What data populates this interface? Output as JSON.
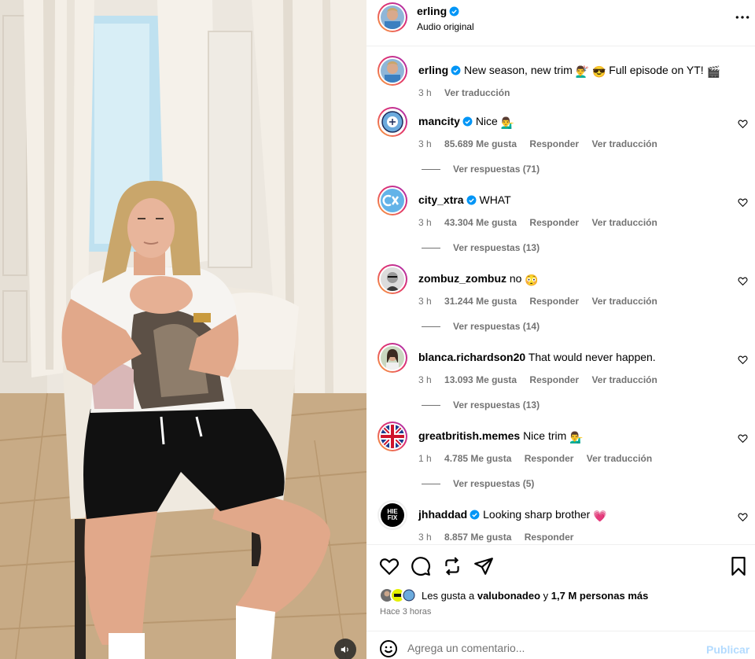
{
  "post": {
    "author": "erling",
    "audio_label": "Audio original",
    "caption_user": "erling",
    "caption_text": "New season, new trim",
    "caption_emoji_1": "💇‍♂️",
    "caption_emoji_2": "😎",
    "caption_text_2": "Full episode on YT!",
    "caption_emoji_3": "🎬",
    "caption_time": "3 h",
    "caption_translate": "Ver traducción"
  },
  "comments": [
    {
      "user": "mancity",
      "verified": true,
      "text": "Nice",
      "emoji": "💁‍♂️",
      "time": "3 h",
      "likes": "85.689 Me gusta",
      "reply": "Responder",
      "translate": "Ver traducción",
      "replies": "Ver respuestas (71)"
    },
    {
      "user": "city_xtra",
      "verified": true,
      "text": "WHAT",
      "emoji": "",
      "time": "3 h",
      "likes": "43.304 Me gusta",
      "reply": "Responder",
      "translate": "Ver traducción",
      "replies": "Ver respuestas (13)"
    },
    {
      "user": "zombuz_zombuz",
      "verified": false,
      "text": "no",
      "emoji": "😳",
      "time": "3 h",
      "likes": "31.244 Me gusta",
      "reply": "Responder",
      "translate": "Ver traducción",
      "replies": "Ver respuestas (14)"
    },
    {
      "user": "blanca.richardson20",
      "verified": false,
      "text": "That would never happen.",
      "emoji": "",
      "time": "3 h",
      "likes": "13.093 Me gusta",
      "reply": "Responder",
      "translate": "Ver traducción",
      "replies": "Ver respuestas (13)"
    },
    {
      "user": "greatbritish.memes",
      "verified": false,
      "text": "Nice trim",
      "emoji": "💁‍♂️",
      "time": "1 h",
      "likes": "4.785 Me gusta",
      "reply": "Responder",
      "translate": "Ver traducción",
      "replies": "Ver respuestas (5)"
    },
    {
      "user": "jhhaddad",
      "verified": true,
      "text": "Looking sharp brother",
      "emoji": "💗",
      "time": "3 h",
      "likes": "8.857 Me gusta",
      "reply": "Responder",
      "translate": "",
      "replies": ""
    }
  ],
  "likes_summary": {
    "prefix": "Les gusta a",
    "user": "valubonadeo",
    "connector": "y",
    "others": "1,7 M personas más"
  },
  "time_ago": "Hace 3 horas",
  "composer": {
    "placeholder": "Agrega un comentario...",
    "post_label": "Publicar"
  },
  "avatar_texts": {
    "jhhaddad": "HIE FIX"
  },
  "icons": {
    "verified": "verified-badge-icon",
    "more": "more-options-icon",
    "heart": "heart-icon",
    "comment": "comment-icon",
    "repost": "repost-icon",
    "share": "share-icon",
    "save": "bookmark-icon",
    "emoji": "emoji-icon",
    "audio": "speaker-icon"
  },
  "colors": {
    "verified": "#0095f6",
    "muted": "#737373",
    "post_disabled": "#b3dbff",
    "divider": "#efefef"
  }
}
